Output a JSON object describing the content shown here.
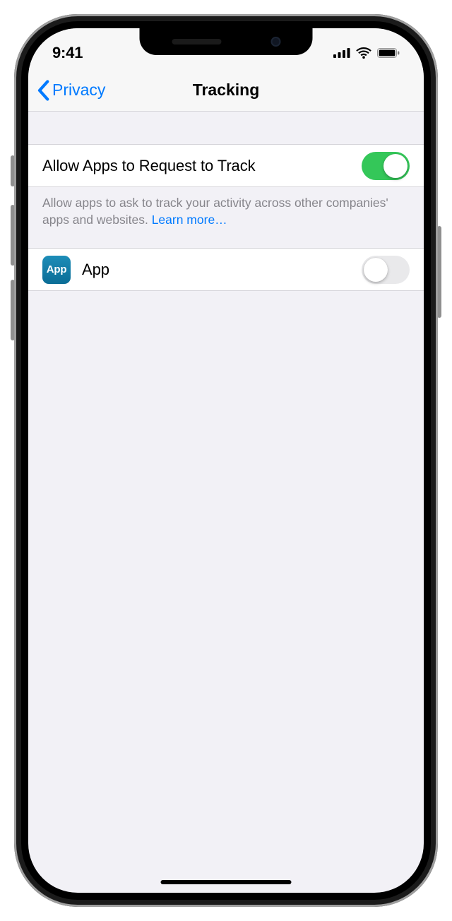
{
  "statusbar": {
    "time": "9:41"
  },
  "nav": {
    "back": "Privacy",
    "title": "Tracking"
  },
  "main_toggle": {
    "label": "Allow Apps to Request to Track",
    "on": true
  },
  "footer": {
    "text": "Allow apps to ask to track your activity across other companies' apps and websites. ",
    "link": "Learn more…"
  },
  "app_row": {
    "icon_label": "App",
    "name": "App",
    "on": false
  }
}
